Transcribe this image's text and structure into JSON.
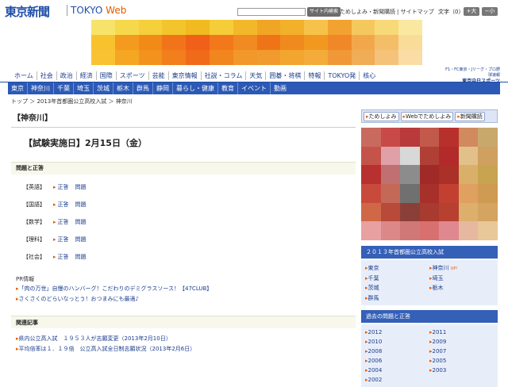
{
  "header": {
    "logo_jp": "東京新聞",
    "logo_en": "TOKYO",
    "logo_web": "Web",
    "search_button": "サイト内検索",
    "top_links": [
      "ためしよみ・新聞購読",
      "サイトマップ"
    ],
    "font_size_label": "文字（0）",
    "font_bigger": "+大",
    "font_smaller": "−小"
  },
  "global_nav": [
    "ホーム",
    "社会",
    "政治",
    "経済",
    "国際",
    "スポーツ",
    "芸能",
    "東京情報",
    "社説・コラム",
    "天気",
    "囲碁・将棋",
    "特報",
    "TOKYO発",
    "核心"
  ],
  "sports_logo": {
    "line1": "F1・FC東京・Jリーグ・プロ野球速報",
    "line2": "東京中日スポーツ"
  },
  "sub_nav": [
    "東京",
    "神奈川",
    "千葉",
    "埼玉",
    "茨城",
    "栃木",
    "群馬",
    "静岡",
    "暮らし・健康",
    "教育",
    "イベント",
    "動画"
  ],
  "breadcrumb": "トップ ＞ 2013年首都圏公立高校入試 ＞ 神奈川",
  "main": {
    "pref_title": "【神奈川】",
    "exam_date": "【試験実施日】2月15日（金）",
    "section1_title": "問題と正答",
    "subjects": [
      {
        "name": "【英語】",
        "answer": "正答",
        "question": "問題"
      },
      {
        "name": "【国語】",
        "answer": "正答",
        "question": "問題"
      },
      {
        "name": "【数学】",
        "answer": "正答",
        "question": "問題"
      },
      {
        "name": "【理科】",
        "answer": "正答",
        "question": "問題"
      },
      {
        "name": "【社会】",
        "answer": "正答",
        "question": "問題"
      }
    ],
    "pr_label": "PR情報",
    "pr_items": [
      "「肉の万世」自慢のハンバーグ！こだわりのデミグラスソース！【47CLUB】",
      "さくさくのどらいなっとう！おつまみにも最適♪"
    ],
    "section2_title": "関連記事",
    "related": [
      "県内公立高入試　１９５３人が志願変更（2013年2月10日）",
      "平均倍率は１．１９倍　公立高入試全日制志願状況（2013年2月6日）"
    ]
  },
  "right": {
    "tabs": [
      "ためしよみ",
      "Webでためしよみ",
      "新聞購読"
    ],
    "exam_box_title": "２０１３年首都圏公立高校入試",
    "exam_prefs": [
      [
        "東京",
        "神奈川"
      ],
      [
        "千葉",
        "埼玉"
      ],
      [
        "茨城",
        "栃木"
      ],
      [
        "群馬",
        ""
      ]
    ],
    "up_mark": "UP!",
    "past_box_title": "過去の問題と正答",
    "past_years": [
      [
        "2012",
        "2011"
      ],
      [
        "2010",
        "2009"
      ],
      [
        "2008",
        "2007"
      ],
      [
        "2006",
        "2005"
      ],
      [
        "2004",
        "2003"
      ],
      [
        "2002",
        ""
      ]
    ]
  },
  "colors": {
    "brand": "#1f4fa8",
    "subnav": "#2c59b5",
    "accent": "#e05a00",
    "section_bg": "#f7f7ec"
  }
}
